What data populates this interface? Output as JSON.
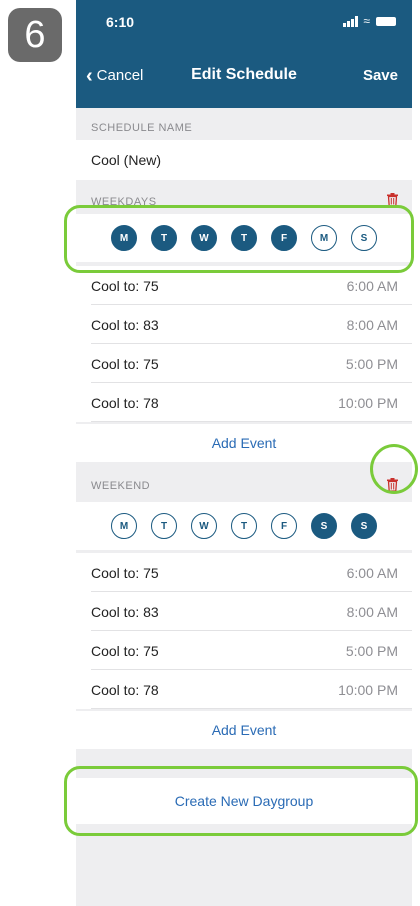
{
  "step_number": "6",
  "status_bar": {
    "time": "6:10"
  },
  "nav": {
    "cancel_label": "Cancel",
    "title": "Edit Schedule",
    "save_label": "Save"
  },
  "schedule_name": {
    "header": "SCHEDULE NAME",
    "value": "Cool (New)"
  },
  "weekdays": {
    "header": "WEEKDAYS",
    "days": [
      {
        "label": "M",
        "selected": true
      },
      {
        "label": "T",
        "selected": true
      },
      {
        "label": "W",
        "selected": true
      },
      {
        "label": "T",
        "selected": true
      },
      {
        "label": "F",
        "selected": true
      },
      {
        "label": "M",
        "selected": false
      },
      {
        "label": "S",
        "selected": false
      }
    ],
    "events": [
      {
        "label": "Cool to: 75",
        "time": "6:00 AM"
      },
      {
        "label": "Cool to: 83",
        "time": "8:00 AM"
      },
      {
        "label": "Cool to: 75",
        "time": "5:00 PM"
      },
      {
        "label": "Cool to: 78",
        "time": "10:00 PM"
      }
    ],
    "add_event_label": "Add Event"
  },
  "weekend": {
    "header": "WEEKEND",
    "days": [
      {
        "label": "M",
        "selected": false
      },
      {
        "label": "T",
        "selected": false
      },
      {
        "label": "W",
        "selected": false
      },
      {
        "label": "T",
        "selected": false
      },
      {
        "label": "F",
        "selected": false
      },
      {
        "label": "S",
        "selected": true
      },
      {
        "label": "S",
        "selected": true
      }
    ],
    "events": [
      {
        "label": "Cool to: 75",
        "time": "6:00 AM"
      },
      {
        "label": "Cool to: 83",
        "time": "8:00 AM"
      },
      {
        "label": "Cool to: 75",
        "time": "5:00 PM"
      },
      {
        "label": "Cool to: 78",
        "time": "10:00 PM"
      }
    ],
    "add_event_label": "Add Event"
  },
  "create_daygroup_label": "Create New Daygroup",
  "colors": {
    "primary": "#1b5a80",
    "link": "#2a6bb5",
    "delete": "#c9302c",
    "highlight": "#7acb3a",
    "background": "#eeeef0"
  }
}
